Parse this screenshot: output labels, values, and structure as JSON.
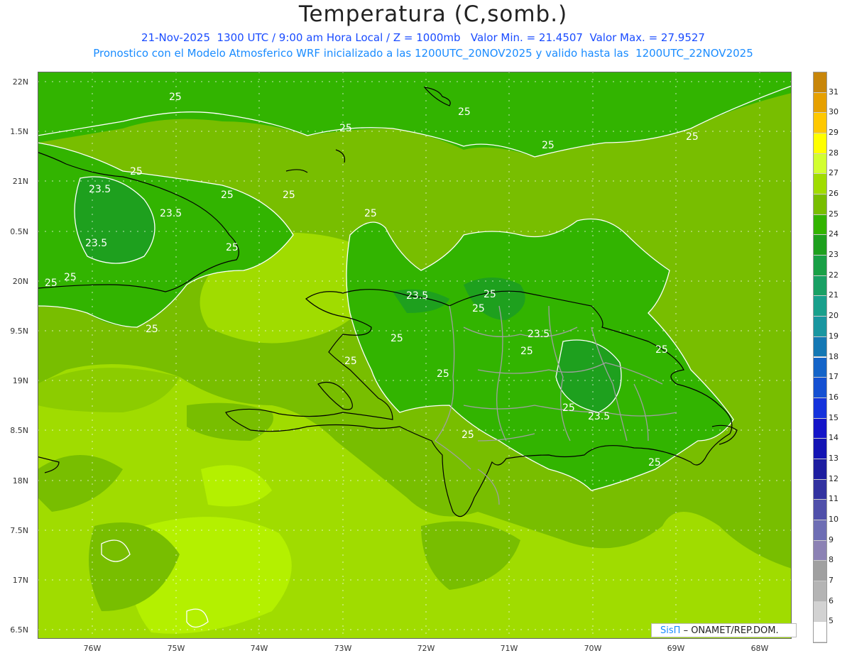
{
  "title": "Temperatura (C,somb.)",
  "subtitle1": "21-Nov-2025  1300 UTC / 9:00 am Hora Local / Z = 1000mb   Valor Min. = 21.4507  Valor Max. = 27.9527",
  "subtitle2": "Pronostico con el Modelo Atmosferico WRF inicializado a las 1200UTC_20NOV2025 y valido hasta las  1200UTC_22NOV2025",
  "lat_labels": [
    "22N",
    "1.5N",
    "21N",
    "0.5N",
    "20N",
    "9.5N",
    "19N",
    "8.5N",
    "18N",
    "7.5N",
    "17N",
    "6.5N"
  ],
  "lon_labels": [
    "76W",
    "75W",
    "74W",
    "73W",
    "72W",
    "71W",
    "70W",
    "69W",
    "68W"
  ],
  "colorbar": {
    "labels": [
      "31",
      "30",
      "29",
      "28",
      "27",
      "26",
      "25",
      "24",
      "23",
      "22",
      "21",
      "20",
      "19",
      "18",
      "17",
      "16",
      "15",
      "14",
      "13",
      "12",
      "11",
      "10",
      "9",
      "8",
      "7",
      "6",
      "5"
    ],
    "colors": [
      "#c8860a",
      "#e6a000",
      "#ffc800",
      "#ffff00",
      "#d2ff30",
      "#a0dc00",
      "#78be00",
      "#32b400",
      "#1ea01e",
      "#19a046",
      "#19a064",
      "#19a08c",
      "#1996a0",
      "#1478b4",
      "#1464c8",
      "#1450d2",
      "#1432dc",
      "#1414c8",
      "#1414b4",
      "#1e1ea0",
      "#3232a0",
      "#5050aa",
      "#6e6eb4",
      "#8c82b4",
      "#a0a0a0",
      "#b4b4b4",
      "#d2d2d2",
      "#ffffff"
    ]
  },
  "contour_labels": [
    "25",
    "23.5",
    "25",
    "25",
    "25",
    "23.5",
    "25",
    "25",
    "25",
    "25",
    "23.5",
    "25",
    "25",
    "25",
    "23.5",
    "25",
    "25",
    "25",
    "23.5",
    "25",
    "25",
    "25",
    "25",
    "25",
    "23.5",
    "25",
    "25",
    "25",
    "25"
  ],
  "credit": {
    "sis": "SisΠ",
    "rest": "– ONAMET/REP.DOM."
  },
  "field_colors": {
    "t24": "#32b400",
    "t25": "#78be00",
    "t26": "#a0dc00",
    "t23": "#1ea01e",
    "t27": "#b4f000"
  }
}
